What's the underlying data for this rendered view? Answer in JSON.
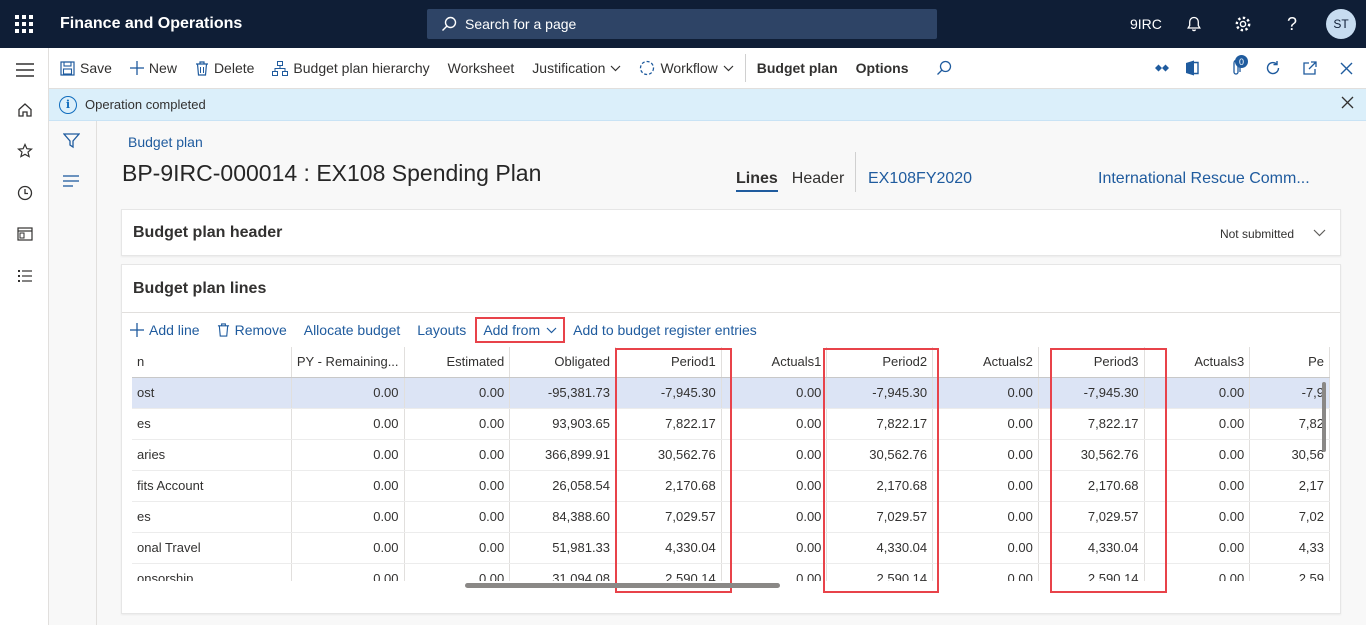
{
  "app": {
    "title": "Finance and Operations",
    "company": "9IRC",
    "user_initials": "ST"
  },
  "search": {
    "placeholder": "Search for a page"
  },
  "actions": {
    "save": "Save",
    "new": "New",
    "delete": "Delete",
    "hierarchy": "Budget plan hierarchy",
    "worksheet": "Worksheet",
    "justification": "Justification",
    "workflow": "Workflow",
    "budget_plan": "Budget plan",
    "options": "Options",
    "notification_count": "0"
  },
  "message": {
    "text": "Operation completed"
  },
  "page": {
    "breadcrumb": "Budget plan",
    "title": "BP-9IRC-000014 : EX108 Spending Plan",
    "tabs": [
      "Lines",
      "Header"
    ],
    "fiscal_link": "EX108FY2020",
    "org_link": "International Rescue Comm..."
  },
  "header_card": {
    "title": "Budget plan header",
    "status": "Not submitted"
  },
  "lines_card": {
    "title": "Budget plan lines",
    "toolbar": {
      "add_line": "Add line",
      "remove": "Remove",
      "allocate": "Allocate budget",
      "layouts": "Layouts",
      "add_from": "Add from",
      "add_to_register": "Add to budget register entries"
    },
    "columns": [
      "n",
      "PY - Remaining...",
      "Estimated",
      "Obligated",
      "Period1",
      "Actuals1",
      "Period2",
      "Actuals2",
      "Period3",
      "Actuals3",
      "Pe"
    ],
    "rows": [
      [
        "ost",
        "0.00",
        "0.00",
        "-95,381.73",
        "-7,945.30",
        "0.00",
        "-7,945.30",
        "0.00",
        "-7,945.30",
        "0.00",
        "-7,9"
      ],
      [
        "es",
        "0.00",
        "0.00",
        "93,903.65",
        "7,822.17",
        "0.00",
        "7,822.17",
        "0.00",
        "7,822.17",
        "0.00",
        "7,82"
      ],
      [
        "aries",
        "0.00",
        "0.00",
        "366,899.91",
        "30,562.76",
        "0.00",
        "30,562.76",
        "0.00",
        "30,562.76",
        "0.00",
        "30,56"
      ],
      [
        "fits Account",
        "0.00",
        "0.00",
        "26,058.54",
        "2,170.68",
        "0.00",
        "2,170.68",
        "0.00",
        "2,170.68",
        "0.00",
        "2,17"
      ],
      [
        "es",
        "0.00",
        "0.00",
        "84,388.60",
        "7,029.57",
        "0.00",
        "7,029.57",
        "0.00",
        "7,029.57",
        "0.00",
        "7,02"
      ],
      [
        "onal Travel",
        "0.00",
        "0.00",
        "51,981.33",
        "4,330.04",
        "0.00",
        "4,330.04",
        "0.00",
        "4,330.04",
        "0.00",
        "4,33"
      ],
      [
        "onsorship",
        "0.00",
        "0.00",
        "31,094.08",
        "2,590.14",
        "0.00",
        "2,590.14",
        "0.00",
        "2,590.14",
        "0.00",
        "2,59"
      ]
    ]
  },
  "colors": {
    "nav_bg": "#0f1e36",
    "accent": "#1f5b9e",
    "highlight": "#e8434a",
    "selected_row": "#dce4f5",
    "message_bg": "#dbeffa"
  }
}
